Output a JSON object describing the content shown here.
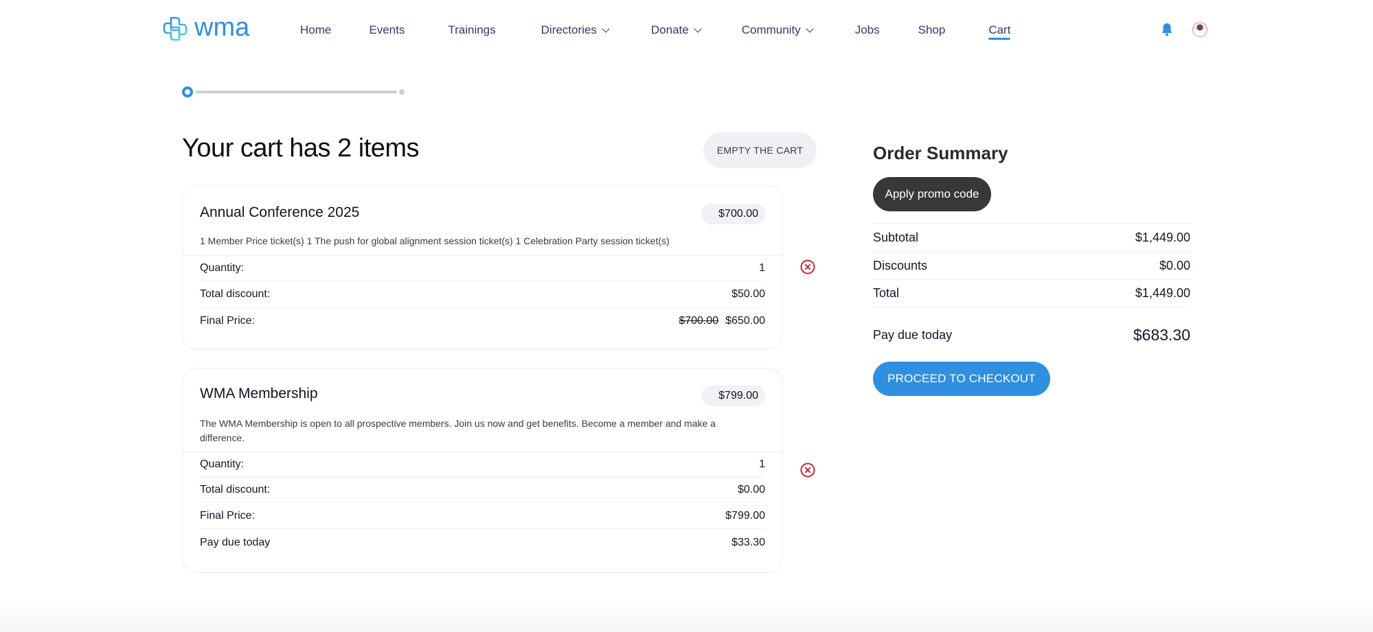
{
  "header": {
    "logo_text": "wma",
    "nav": [
      {
        "label": "Home",
        "dropdown": false,
        "active": false
      },
      {
        "label": "Events",
        "dropdown": false,
        "active": false
      },
      {
        "label": "Trainings",
        "dropdown": false,
        "active": false
      },
      {
        "label": "Directories",
        "dropdown": true,
        "active": false
      },
      {
        "label": "Donate",
        "dropdown": true,
        "active": false
      },
      {
        "label": "Community",
        "dropdown": true,
        "active": false
      },
      {
        "label": "Jobs",
        "dropdown": false,
        "active": false
      },
      {
        "label": "Shop",
        "dropdown": false,
        "active": false
      },
      {
        "label": "Cart",
        "dropdown": false,
        "active": true
      }
    ],
    "icons": {
      "notifications": "bell-icon",
      "profile": "avatar"
    }
  },
  "stepper": {
    "current_step": 1,
    "total_steps": 2,
    "progress": 0
  },
  "cart": {
    "title": "Your cart has 2 items",
    "empty_button": "EMPTY THE CART",
    "items": [
      {
        "name": "Annual Conference 2025",
        "price": "$700.00",
        "description": "1 Member Price ticket(s) 1 The push for global alignment session ticket(s) 1 Celebration Party session ticket(s)",
        "rows": [
          {
            "label": "Quantity:",
            "value": "1"
          },
          {
            "label": "Total discount:",
            "value": "$50.00"
          },
          {
            "label": "Final Price:",
            "original": "$700.00",
            "value": "$650.00"
          }
        ]
      },
      {
        "name": "WMA Membership",
        "price": "$799.00",
        "description": "The WMA Membership is open to all prospective members. Join us now and get benefits. Become a member and make a difference.",
        "rows": [
          {
            "label": "Quantity:",
            "value": "1"
          },
          {
            "label": "Total discount:",
            "value": "$0.00"
          },
          {
            "label": "Final Price:",
            "value": "$799.00"
          },
          {
            "label": "Pay due today",
            "value": "$33.30"
          }
        ]
      }
    ]
  },
  "summary": {
    "title": "Order Summary",
    "promo_button": "Apply promo code",
    "rows": [
      {
        "label": "Subtotal",
        "value": "$1,449.00"
      },
      {
        "label": "Discounts",
        "value": "$0.00"
      },
      {
        "label": "Total",
        "value": "$1,449.00"
      }
    ],
    "pay_due_label": "Pay due today",
    "pay_due_value": "$683.30",
    "checkout_button": "PROCEED TO CHECKOUT"
  },
  "colors": {
    "accent": "#2f8fe0",
    "remove": "#c8243c",
    "dark_button": "#383838"
  }
}
